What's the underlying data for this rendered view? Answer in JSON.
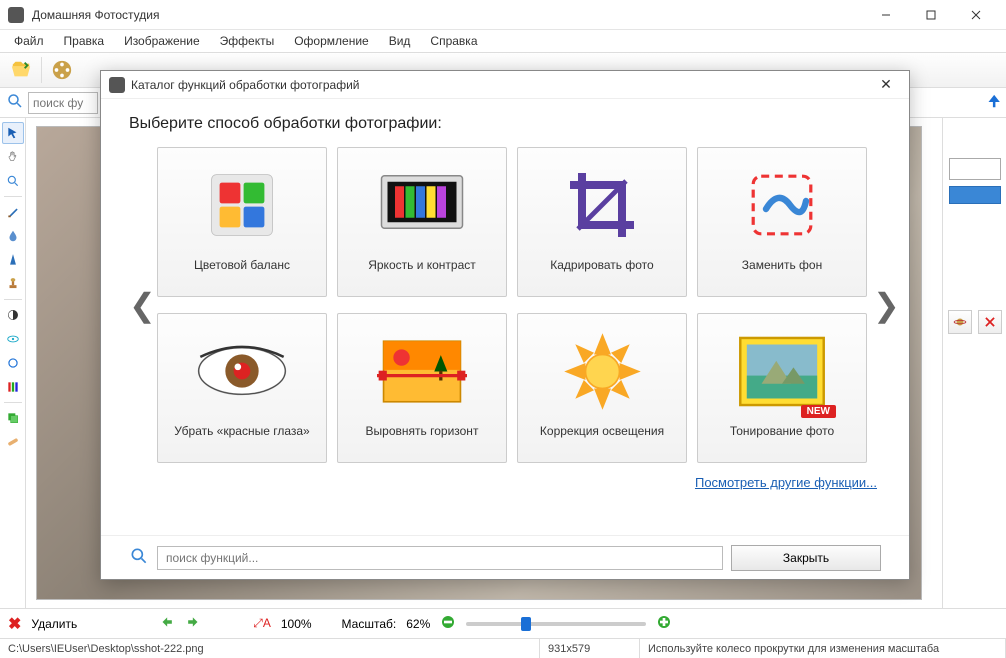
{
  "app": {
    "title": "Домашняя Фотостудия"
  },
  "menu": [
    "Файл",
    "Правка",
    "Изображение",
    "Эффекты",
    "Оформление",
    "Вид",
    "Справка"
  ],
  "search": {
    "placeholder": "поиск фу"
  },
  "bottom": {
    "delete_label": "Удалить",
    "zoom_fit": "100%",
    "scale_label": "Масштаб:",
    "scale_value": "62%"
  },
  "status": {
    "path": "C:\\Users\\IEUser\\Desktop\\sshot-222.png",
    "dims": "931x579",
    "hint": "Используйте колесо прокрутки для изменения масштаба"
  },
  "dialog": {
    "title": "Каталог функций обработки фотографий",
    "heading": "Выберите способ обработки фотографии:",
    "cards": [
      {
        "label": "Цветовой баланс"
      },
      {
        "label": "Яркость и контраст"
      },
      {
        "label": "Кадрировать фото"
      },
      {
        "label": "Заменить фон"
      },
      {
        "label": "Убрать «красные глаза»"
      },
      {
        "label": "Выровнять горизонт"
      },
      {
        "label": "Коррекция освещения"
      },
      {
        "label": "Тонирование фото",
        "badge": "NEW"
      }
    ],
    "more_link": "Посмотреть другие функции...",
    "search_placeholder": "поиск функций...",
    "close_label": "Закрыть"
  }
}
